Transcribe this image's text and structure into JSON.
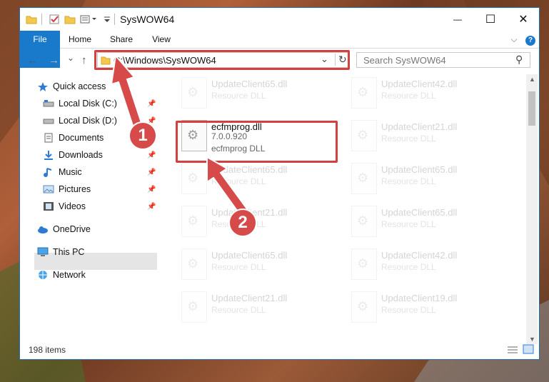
{
  "window": {
    "title": "SysWOW64",
    "minimize": "—",
    "maximize": "☐",
    "close": "✕",
    "help": "?",
    "ribbon_collapse": "⌵"
  },
  "ribbon": {
    "tabs": [
      {
        "label": "File"
      },
      {
        "label": "Home"
      },
      {
        "label": "Share"
      },
      {
        "label": "View"
      }
    ]
  },
  "address_bar": {
    "back": "←",
    "forward": "→",
    "recent": "⌄",
    "up": "↑",
    "path": "C:\\Windows\\SysWOW64",
    "dropdown": "⌄",
    "refresh": "↻",
    "search_placeholder": "Search SysWOW64",
    "search_icon": "⚲"
  },
  "nav": {
    "items": [
      {
        "label": "Quick access",
        "icon": "star-icon",
        "pinned": false
      },
      {
        "label": "Local Disk (C:)",
        "icon": "drive-icon",
        "pinned": true
      },
      {
        "label": "Local Disk (D:)",
        "icon": "drive-icon",
        "pinned": true
      },
      {
        "label": "Documents",
        "icon": "documents-icon",
        "pinned": true
      },
      {
        "label": "Downloads",
        "icon": "downloads-icon",
        "pinned": true
      },
      {
        "label": "Music",
        "icon": "music-icon",
        "pinned": true
      },
      {
        "label": "Pictures",
        "icon": "pictures-icon",
        "pinned": true
      },
      {
        "label": "Videos",
        "icon": "videos-icon",
        "pinned": true
      },
      {
        "label": "OneDrive",
        "icon": "cloud-icon",
        "pinned": false
      },
      {
        "label": "This PC",
        "icon": "computer-icon",
        "pinned": false
      },
      {
        "label": "Network",
        "icon": "network-icon",
        "pinned": false
      }
    ]
  },
  "files": {
    "highlighted": {
      "name": "ecfmprog.dll",
      "version": "7.0.0.920",
      "description": "ecfmprog DLL"
    },
    "items": [
      {
        "name": "UpdateClient65.dll",
        "description": "Resource DLL"
      },
      {
        "name": "UpdateClient42.dll",
        "description": "Resource DLL"
      },
      {
        "name": "UpdateClient21.dll",
        "description": "Resource DLL"
      },
      {
        "name": "UpdateClient65.dll",
        "description": "Resource DLL"
      },
      {
        "name": "UpdateClient65.dll",
        "description": "Resource DLL"
      },
      {
        "name": "UpdateClient21.dll",
        "description": "Resource DLL"
      },
      {
        "name": "UpdateClient65.dll",
        "description": "Resource DLL"
      },
      {
        "name": "UpdateClient65.dll",
        "description": "Resource DLL"
      },
      {
        "name": "UpdateClient42.dll",
        "description": "Resource DLL"
      },
      {
        "name": "UpdateClient21.dll",
        "description": "Resource DLL"
      },
      {
        "name": "UpdateClient19.dll",
        "description": "Resource DLL"
      }
    ]
  },
  "status": {
    "item_count": "198 items"
  },
  "annotations": {
    "step1": "1",
    "step2": "2"
  },
  "colors": {
    "accent": "#1979ca",
    "highlight": "#d24040"
  }
}
